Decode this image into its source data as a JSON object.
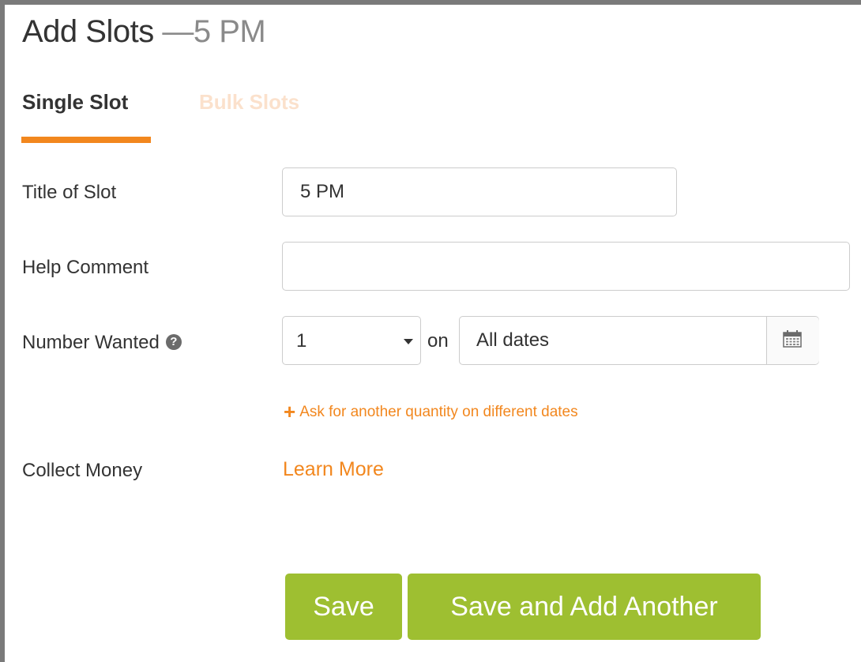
{
  "dialog": {
    "title": "Add Slots",
    "title_suffix": "—5 PM"
  },
  "tabs": [
    {
      "label": "Single Slot",
      "active": true
    },
    {
      "label": "Bulk Slots",
      "active": false
    }
  ],
  "form": {
    "title_of_slot": {
      "label": "Title of Slot",
      "value": "5 PM"
    },
    "help_comment": {
      "label": "Help Comment",
      "value": ""
    },
    "number_wanted": {
      "label": "Number Wanted",
      "help_icon": "question-circle-icon",
      "quantity": "1",
      "on_label": "on",
      "dates_value": "All dates",
      "calendar_icon": "calendar-icon"
    },
    "add_quantity_link": "Ask for another quantity on different dates",
    "collect_money": {
      "label": "Collect Money",
      "link": "Learn More"
    }
  },
  "buttons": {
    "save": "Save",
    "save_and_add": "Save and Add Another"
  },
  "colors": {
    "accent_orange": "#f2871e",
    "button_green": "#9ebf31",
    "inactive_tab": "#fbe1cc"
  }
}
